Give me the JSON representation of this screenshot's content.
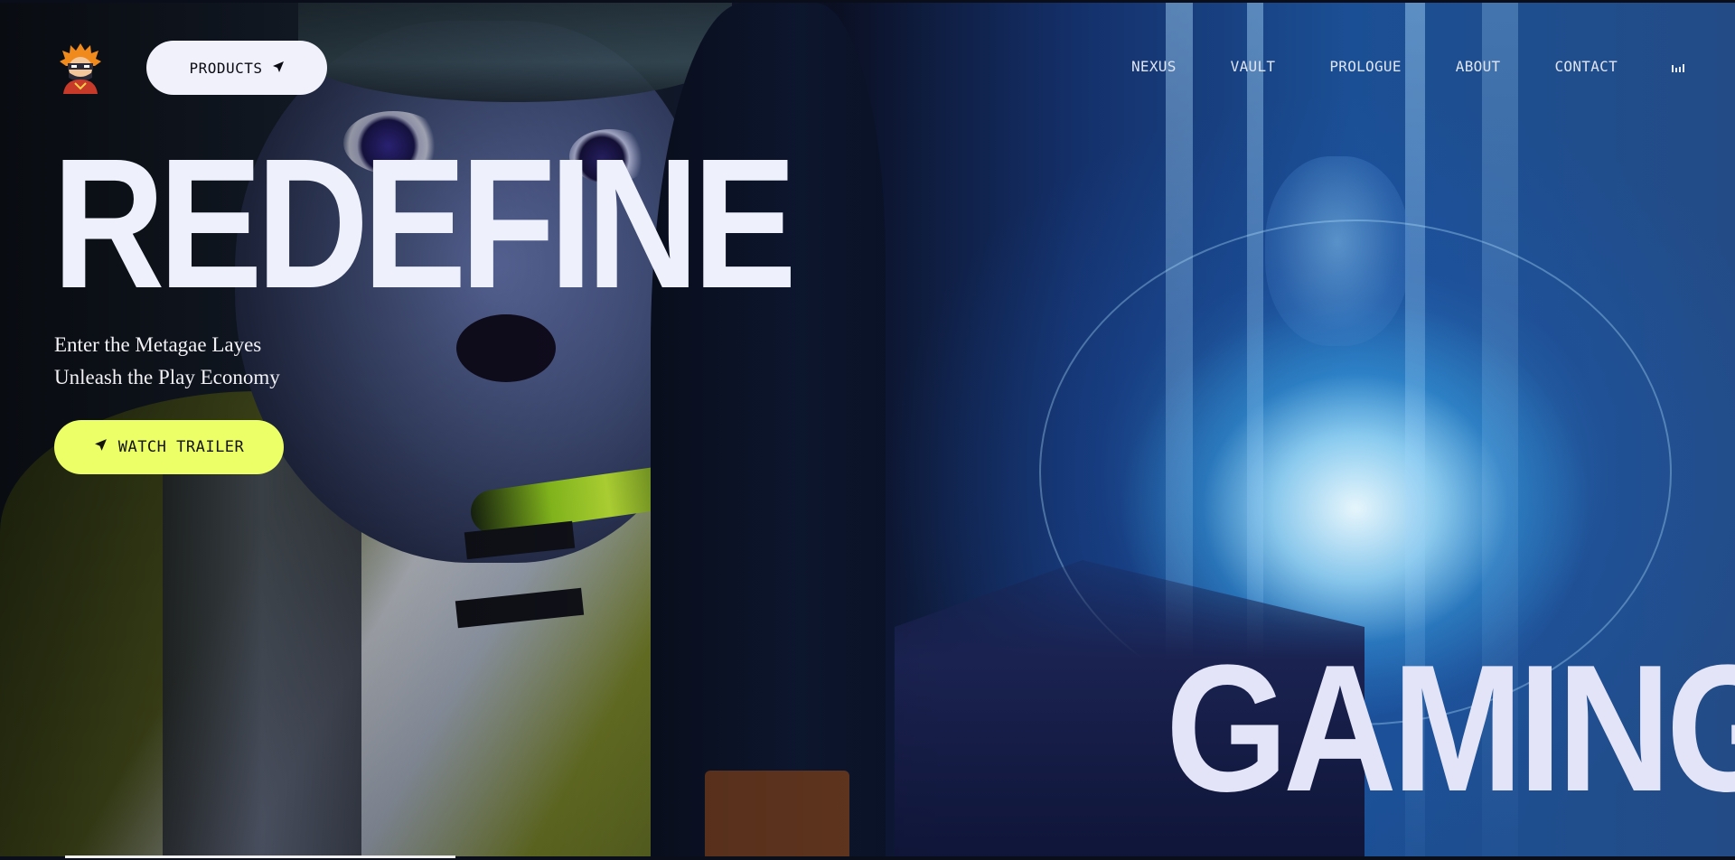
{
  "header": {
    "logo_icon": "ninja-mascot-icon",
    "products_button": {
      "label": "PRODUCTS",
      "icon": "navigation-arrow-icon"
    },
    "nav_items": [
      "NEXUS",
      "VAULT",
      "PROLOGUE",
      "ABOUT",
      "CONTACT"
    ],
    "audio_icon": "audio-bars-icon"
  },
  "hero": {
    "headline": "REDEFINE",
    "tagline_lines": [
      "Enter the Metagae Layes",
      "Unleash the Play Economy"
    ],
    "trailer_button": {
      "label": "WATCH TRAILER",
      "icon": "navigation-arrow-icon"
    },
    "corner_word": "GAMING"
  },
  "colors": {
    "accent_yellow": "#edff66",
    "pill_white": "#f1f1fb",
    "headline_text": "#eef1fb"
  }
}
